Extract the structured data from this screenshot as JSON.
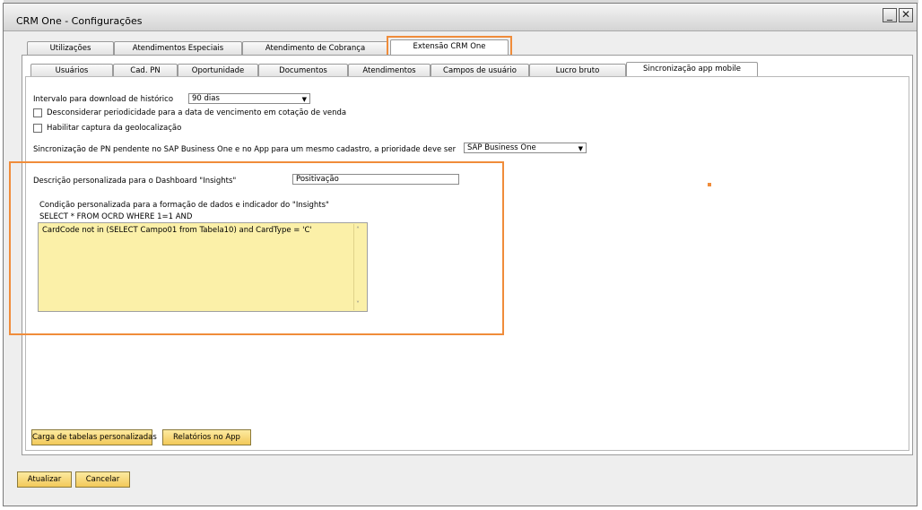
{
  "window": {
    "title": "CRM One - Configurações"
  },
  "top_tabs": [
    {
      "label": "Utilizações"
    },
    {
      "label": "Atendimentos Especiais"
    },
    {
      "label": "Atendimento de Cobrança"
    },
    {
      "label": "Extensão CRM One",
      "active": true
    }
  ],
  "sub_tabs": [
    {
      "label": "Usuários"
    },
    {
      "label": "Cad. PN"
    },
    {
      "label": "Oportunidade"
    },
    {
      "label": "Documentos"
    },
    {
      "label": "Atendimentos"
    },
    {
      "label": "Campos de usuário"
    },
    {
      "label": "Lucro bruto"
    },
    {
      "label": "Sincronização app mobile",
      "active": true
    }
  ],
  "form": {
    "historico_label": "Intervalo para download de histórico",
    "historico_value": "90 dias",
    "desconsiderar_label": "Desconsiderar periodicidade para a data de vencimento em cotação de venda",
    "geolocalizacao_label": "Habilitar captura da geolocalização",
    "sincronizacao_label": "Sincronização de PN pendente no SAP Business One e no App para um mesmo cadastro, a prioridade deve ser",
    "sincronizacao_value": "SAP Business One",
    "descricao_label": "Descrição personalizada para o Dashboard \"Insights\"",
    "descricao_value": "Positivação",
    "condicao_label": "Condição personalizada para a formação de dados e indicador do \"Insights\"",
    "sql_prefix": "SELECT * FROM OCRD WHERE 1=1 AND",
    "sql_condition": "CardCode not in (SELECT Campo01 from Tabela10) and CardType = 'C'"
  },
  "buttons": {
    "carga": "Carga de tabelas personalizadas",
    "relatorios": "Relatórios no App",
    "atualizar": "Atualizar",
    "cancelar": "Cancelar"
  },
  "colors": {
    "accent_highlight": "#f08c3a",
    "button": "#f2c95a",
    "textarea_bg": "#fbf0a8"
  }
}
